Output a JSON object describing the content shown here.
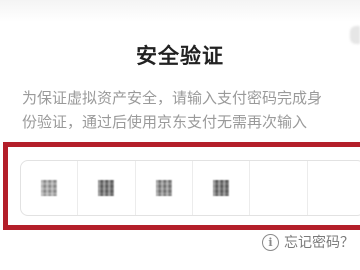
{
  "dialog": {
    "title": "安全验证",
    "description_lines": [
      "为保证虚拟资产安全，请输入支付密码完成身",
      "份验证，通过后使用京东支付无需再次输入"
    ]
  },
  "password": {
    "length": 6,
    "entered_count": 4,
    "cells": [
      {
        "filled": true
      },
      {
        "filled": true
      },
      {
        "filled": true
      },
      {
        "filled": true
      },
      {
        "filled": false
      },
      {
        "filled": false
      }
    ]
  },
  "forgot": {
    "label": "忘记密码？",
    "icon": "info-icon"
  },
  "colors": {
    "highlight_border": "#b41f2a",
    "title_text": "#222222",
    "description_text": "#9a9a9a"
  }
}
